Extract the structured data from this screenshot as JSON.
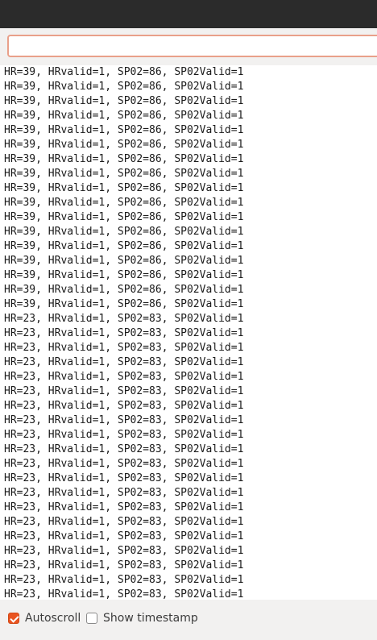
{
  "send_input": {
    "value": "",
    "placeholder": ""
  },
  "serial_output": {
    "lines": [
      "HR=39, HRvalid=1, SP02=86, SP02Valid=1",
      "HR=39, HRvalid=1, SP02=86, SP02Valid=1",
      "HR=39, HRvalid=1, SP02=86, SP02Valid=1",
      "HR=39, HRvalid=1, SP02=86, SP02Valid=1",
      "HR=39, HRvalid=1, SP02=86, SP02Valid=1",
      "HR=39, HRvalid=1, SP02=86, SP02Valid=1",
      "HR=39, HRvalid=1, SP02=86, SP02Valid=1",
      "HR=39, HRvalid=1, SP02=86, SP02Valid=1",
      "HR=39, HRvalid=1, SP02=86, SP02Valid=1",
      "HR=39, HRvalid=1, SP02=86, SP02Valid=1",
      "HR=39, HRvalid=1, SP02=86, SP02Valid=1",
      "HR=39, HRvalid=1, SP02=86, SP02Valid=1",
      "HR=39, HRvalid=1, SP02=86, SP02Valid=1",
      "HR=39, HRvalid=1, SP02=86, SP02Valid=1",
      "HR=39, HRvalid=1, SP02=86, SP02Valid=1",
      "HR=39, HRvalid=1, SP02=86, SP02Valid=1",
      "HR=39, HRvalid=1, SP02=86, SP02Valid=1",
      "HR=23, HRvalid=1, SP02=83, SP02Valid=1",
      "HR=23, HRvalid=1, SP02=83, SP02Valid=1",
      "HR=23, HRvalid=1, SP02=83, SP02Valid=1",
      "HR=23, HRvalid=1, SP02=83, SP02Valid=1",
      "HR=23, HRvalid=1, SP02=83, SP02Valid=1",
      "HR=23, HRvalid=1, SP02=83, SP02Valid=1",
      "HR=23, HRvalid=1, SP02=83, SP02Valid=1",
      "HR=23, HRvalid=1, SP02=83, SP02Valid=1",
      "HR=23, HRvalid=1, SP02=83, SP02Valid=1",
      "HR=23, HRvalid=1, SP02=83, SP02Valid=1",
      "HR=23, HRvalid=1, SP02=83, SP02Valid=1",
      "HR=23, HRvalid=1, SP02=83, SP02Valid=1",
      "HR=23, HRvalid=1, SP02=83, SP02Valid=1",
      "HR=23, HRvalid=1, SP02=83, SP02Valid=1",
      "HR=23, HRvalid=1, SP02=83, SP02Valid=1",
      "HR=23, HRvalid=1, SP02=83, SP02Valid=1",
      "HR=23, HRvalid=1, SP02=83, SP02Valid=1",
      "HR=23, HRvalid=1, SP02=83, SP02Valid=1",
      "HR=23, HRvalid=1, SP02=83, SP02Valid=1",
      "HR=23, HRvalid=1, SP02=83, SP02Valid=1"
    ]
  },
  "footer": {
    "autoscroll": {
      "label": "Autoscroll",
      "checked": true
    },
    "show_timestamp": {
      "label": "Show timestamp",
      "checked": false
    }
  },
  "colors": {
    "titlebar": "#2b2b2b",
    "accent": "#e95420",
    "input_border": "#e9a08a",
    "panel": "#f2f1f0"
  }
}
